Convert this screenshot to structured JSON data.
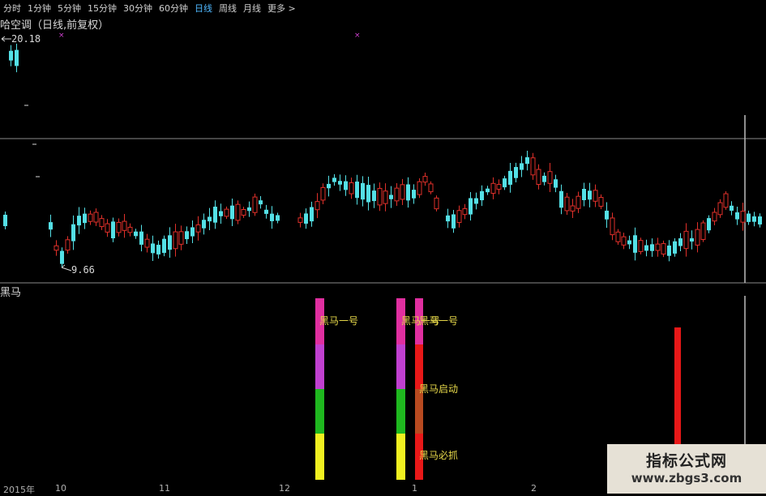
{
  "toolbar": {
    "timeframes": [
      "分时",
      "1分钟",
      "5分钟",
      "15分钟",
      "30分钟",
      "60分钟",
      "日线",
      "周线",
      "月线"
    ],
    "active": "日线",
    "more_label": "更多 >"
  },
  "main_chart": {
    "title": "哈空调（日线,前复权）",
    "high_label": "20.18",
    "low_label": "9.66",
    "up_color": "#e0302a",
    "down_color": "#54e0e6"
  },
  "indicator": {
    "title": "黑马",
    "labels": {
      "a": "黑马一号",
      "b": "黑马一号",
      "c": "黑马一号",
      "d": "黑马启动",
      "e": "黑马必抓"
    },
    "colors": {
      "magenta": "#e02fa0",
      "purple": "#c040d0",
      "green": "#1fb81f",
      "yellow": "#f0f020",
      "red": "#e81818"
    }
  },
  "x_axis": {
    "year": "2015年",
    "months": [
      "10",
      "11",
      "12",
      "1",
      "2"
    ]
  },
  "watermark": {
    "line1": "指标公式网",
    "line2": "www.zbgs3.com"
  }
}
